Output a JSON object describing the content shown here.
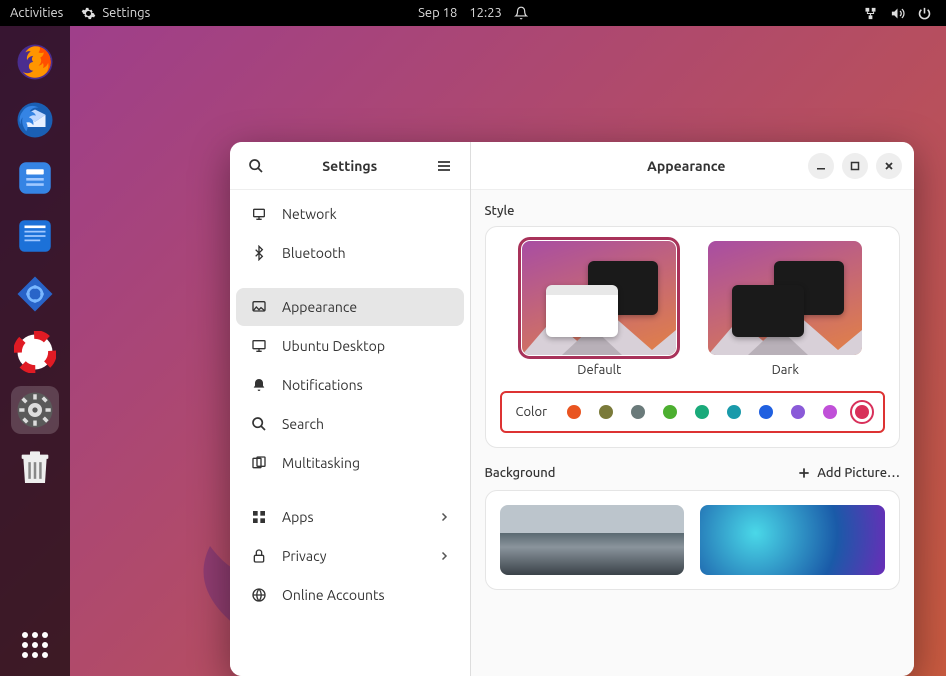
{
  "topbar": {
    "activities": "Activities",
    "app_label": "Settings",
    "date": "Sep 18",
    "time": "12:23"
  },
  "window": {
    "sidebar_title": "Settings",
    "content_title": "Appearance"
  },
  "sidebar": {
    "items": [
      {
        "label": "Network",
        "icon": "network"
      },
      {
        "label": "Bluetooth",
        "icon": "bluetooth"
      },
      {
        "label": "Appearance",
        "icon": "appearance",
        "selected": true
      },
      {
        "label": "Ubuntu Desktop",
        "icon": "desktop"
      },
      {
        "label": "Notifications",
        "icon": "bell"
      },
      {
        "label": "Search",
        "icon": "search"
      },
      {
        "label": "Multitasking",
        "icon": "multitask"
      },
      {
        "label": "Apps",
        "icon": "apps",
        "chevron": true
      },
      {
        "label": "Privacy",
        "icon": "privacy",
        "chevron": true
      },
      {
        "label": "Online Accounts",
        "icon": "accounts"
      }
    ]
  },
  "appearance": {
    "style_label": "Style",
    "styles": [
      {
        "label": "Default",
        "selected": true,
        "variant": "light"
      },
      {
        "label": "Dark",
        "selected": false,
        "variant": "dark"
      }
    ],
    "color_label": "Color",
    "colors": [
      {
        "hex": "#e95420"
      },
      {
        "hex": "#7a7a3a"
      },
      {
        "hex": "#6a7a7a"
      },
      {
        "hex": "#4caf30"
      },
      {
        "hex": "#1aaa7a"
      },
      {
        "hex": "#1a9aaa"
      },
      {
        "hex": "#2060e0"
      },
      {
        "hex": "#8a5ad8"
      },
      {
        "hex": "#c050d8"
      },
      {
        "hex": "#d8305a",
        "selected": true
      }
    ],
    "background_label": "Background",
    "add_picture_label": "Add Picture…"
  }
}
